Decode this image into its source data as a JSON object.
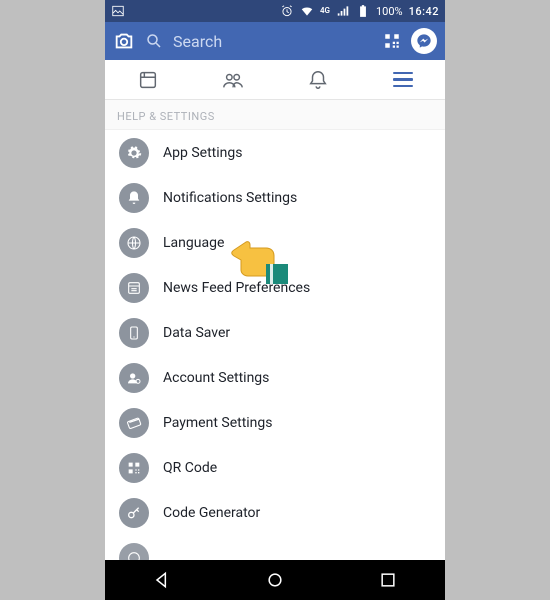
{
  "status": {
    "network_label": "4G",
    "battery_text": "100%",
    "time": "16:42"
  },
  "appbar": {
    "search_placeholder": "Search"
  },
  "section_title": "HELP & SETTINGS",
  "settings": [
    {
      "label": "App Settings",
      "icon": "gear"
    },
    {
      "label": "Notifications Settings",
      "icon": "bell"
    },
    {
      "label": "Language",
      "icon": "globe"
    },
    {
      "label": "News Feed Preferences",
      "icon": "feed"
    },
    {
      "label": "Data Saver",
      "icon": "phone"
    },
    {
      "label": "Account Settings",
      "icon": "account"
    },
    {
      "label": "Payment Settings",
      "icon": "card"
    },
    {
      "label": "QR Code",
      "icon": "qr"
    },
    {
      "label": "Code Generator",
      "icon": "key"
    }
  ]
}
